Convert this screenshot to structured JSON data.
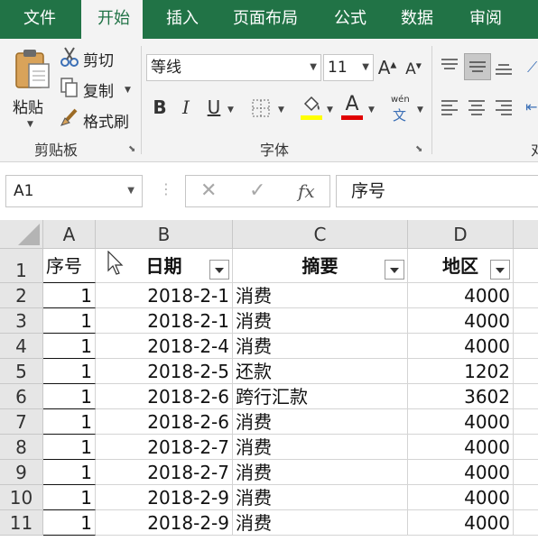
{
  "ribbon_tabs": [
    {
      "label": "文件",
      "active": false
    },
    {
      "label": "开始",
      "active": true
    },
    {
      "label": "插入",
      "active": false
    },
    {
      "label": "页面布局",
      "active": false
    },
    {
      "label": "公式",
      "active": false
    },
    {
      "label": "数据",
      "active": false
    },
    {
      "label": "审阅",
      "active": false
    }
  ],
  "clipboard": {
    "paste_label": "粘贴",
    "cut_label": "剪切",
    "copy_label": "复制",
    "format_painter_label": "格式刷",
    "group_label": "剪贴板"
  },
  "font": {
    "font_name": "等线",
    "font_size": "11",
    "bold_glyph": "B",
    "italic_glyph": "I",
    "underline_glyph": "U",
    "font_color_glyph": "A",
    "phonetic_top": "wén",
    "phonetic_bottom": "文",
    "group_label": "字体",
    "highlight_color": "#ffff00",
    "font_color": "#e00000"
  },
  "alignment": {
    "partial_label": "对"
  },
  "formula_bar": {
    "name_box": "A1",
    "fx_label": "fx",
    "content": "序号"
  },
  "sheet": {
    "columns": [
      "A",
      "B",
      "C",
      "D"
    ],
    "header_row": [
      "序号",
      "日期",
      "摘要",
      "地区"
    ],
    "row_numbers": [
      "1",
      "2",
      "3",
      "4",
      "5",
      "6",
      "7",
      "8",
      "9",
      "10",
      "11"
    ],
    "rows": [
      [
        "1",
        "2018-2-1",
        "消费",
        "4000"
      ],
      [
        "1",
        "2018-2-1",
        "消费",
        "4000"
      ],
      [
        "1",
        "2018-2-4",
        "消费",
        "4000"
      ],
      [
        "1",
        "2018-2-5",
        "还款",
        "1202"
      ],
      [
        "1",
        "2018-2-6",
        "跨行汇款",
        "3602"
      ],
      [
        "1",
        "2018-2-6",
        "消费",
        "4000"
      ],
      [
        "1",
        "2018-2-7",
        "消费",
        "4000"
      ],
      [
        "1",
        "2018-2-7",
        "消费",
        "4000"
      ],
      [
        "1",
        "2018-2-9",
        "消费",
        "4000"
      ],
      [
        "1",
        "2018-2-9",
        "消费",
        "4000"
      ]
    ]
  },
  "colors": {
    "accent": "#217346"
  }
}
